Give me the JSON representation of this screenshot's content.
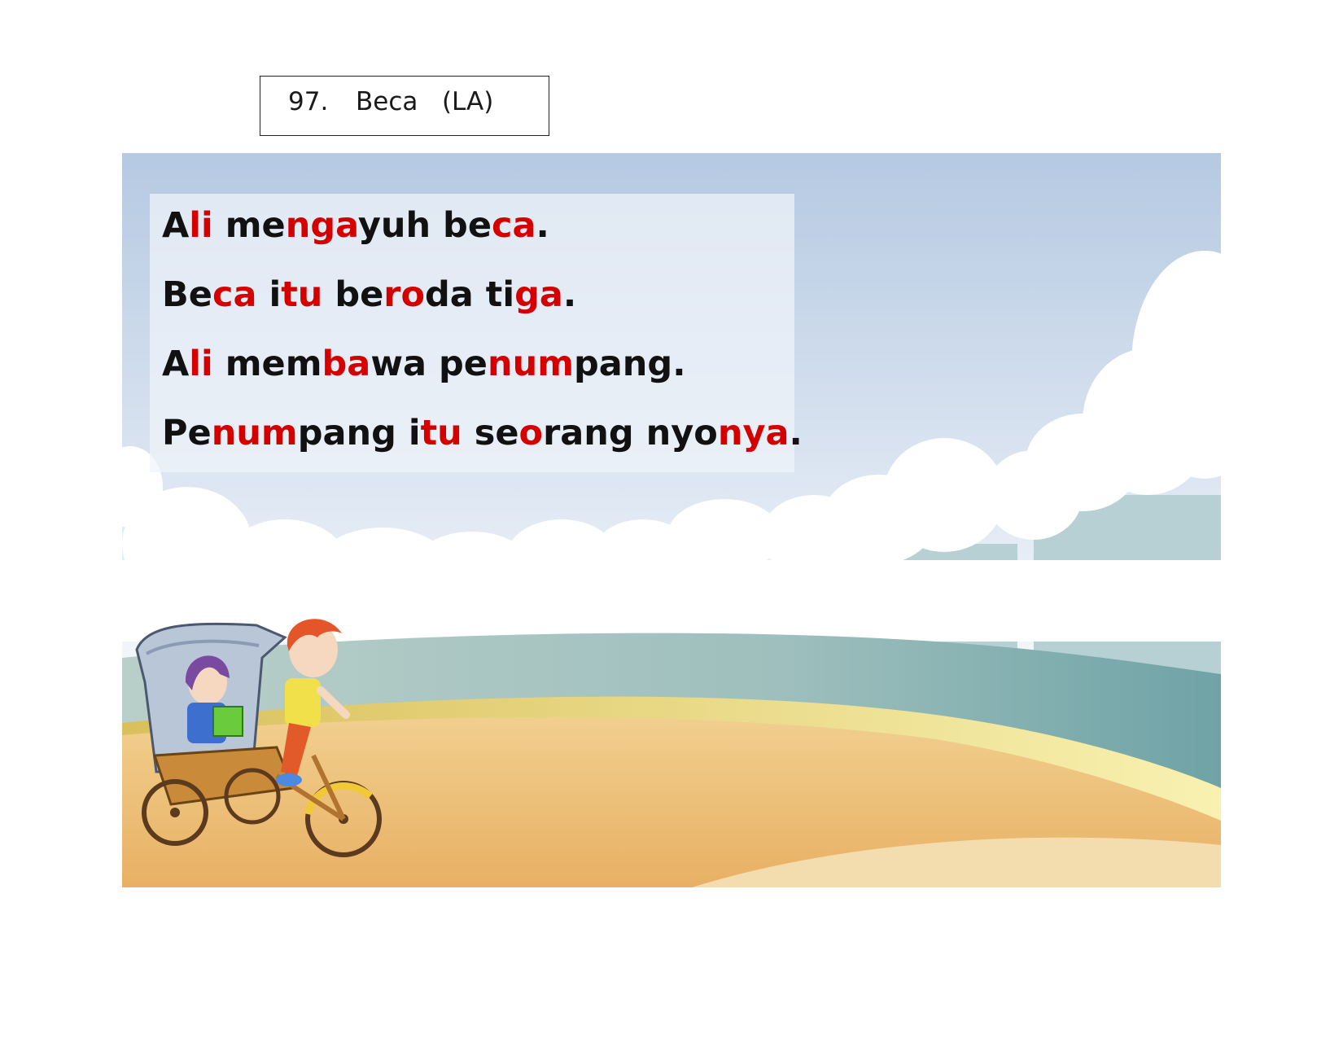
{
  "title": {
    "number": "97.",
    "text": "Beca   (LA)"
  },
  "sentences": [
    {
      "segments": [
        {
          "t": "A",
          "hl": false
        },
        {
          "t": "li",
          "hl": true
        },
        {
          "t": " me",
          "hl": false
        },
        {
          "t": "nga",
          "hl": true
        },
        {
          "t": "yuh be",
          "hl": false
        },
        {
          "t": "ca",
          "hl": true
        },
        {
          "t": ".",
          "hl": false
        }
      ]
    },
    {
      "segments": [
        {
          "t": "Be",
          "hl": false
        },
        {
          "t": "ca",
          "hl": true
        },
        {
          "t": " i",
          "hl": false
        },
        {
          "t": "tu",
          "hl": true
        },
        {
          "t": " be",
          "hl": false
        },
        {
          "t": "ro",
          "hl": true
        },
        {
          "t": "da ti",
          "hl": false
        },
        {
          "t": "ga",
          "hl": true
        },
        {
          "t": ".",
          "hl": false
        }
      ]
    },
    {
      "segments": [
        {
          "t": "A",
          "hl": false
        },
        {
          "t": "li",
          "hl": true
        },
        {
          "t": " mem",
          "hl": false
        },
        {
          "t": "ba",
          "hl": true
        },
        {
          "t": "wa pe",
          "hl": false
        },
        {
          "t": "num",
          "hl": true
        },
        {
          "t": "pang.",
          "hl": false
        }
      ]
    },
    {
      "segments": [
        {
          "t": "Pe",
          "hl": false
        },
        {
          "t": "num",
          "hl": true
        },
        {
          "t": "pang i",
          "hl": false
        },
        {
          "t": "tu",
          "hl": true
        },
        {
          "t": " se",
          "hl": false
        },
        {
          "t": "o",
          "hl": true
        },
        {
          "t": "rang nyo",
          "hl": false
        },
        {
          "t": "nya",
          "hl": true
        },
        {
          "t": ".",
          "hl": false
        }
      ]
    }
  ],
  "colors": {
    "text": "#111111",
    "highlight": "#d40000"
  },
  "illustration": {
    "subject": "boy pedalling a trishaw carrying a passenger",
    "icons": [
      "trishaw-icon",
      "boy-icon",
      "passenger-icon"
    ]
  }
}
